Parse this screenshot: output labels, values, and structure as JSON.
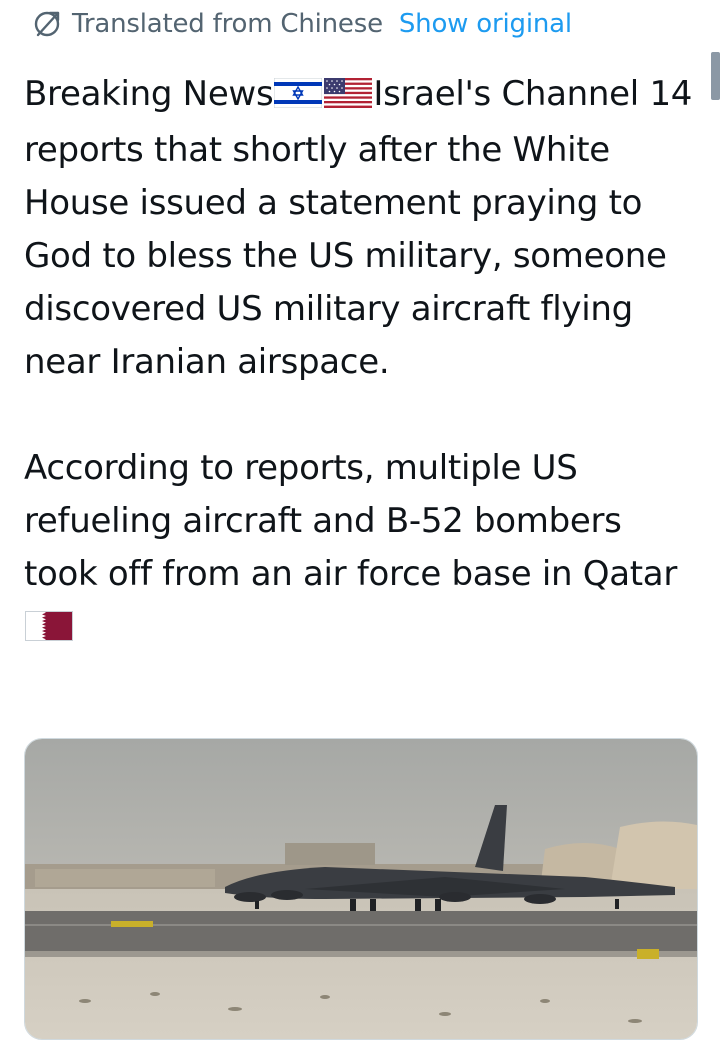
{
  "translation": {
    "label": "Translated from Chinese",
    "action": "Show original"
  },
  "tweet": {
    "para1_part1": "Breaking News",
    "para1_flags": [
      "israel-flag-icon",
      "us-flag-icon"
    ],
    "para1_part2": "Israel's Channel 14 reports that shortly after the White House issued a statement praying to God to bless the US military, someone discovered US military aircraft flying near Iranian airspace.",
    "para2_part1": "According to reports, multiple US refueling aircraft and B-52 bombers took off from an air force base in Qatar",
    "para2_flag": "qatar-flag-icon"
  },
  "media": {
    "type": "photo",
    "subject": "b-52-bomber-on-runway"
  },
  "colors": {
    "text": "#0f1419",
    "secondary": "#536471",
    "link": "#1d9bf0",
    "qatar_maroon": "#8a1538"
  }
}
